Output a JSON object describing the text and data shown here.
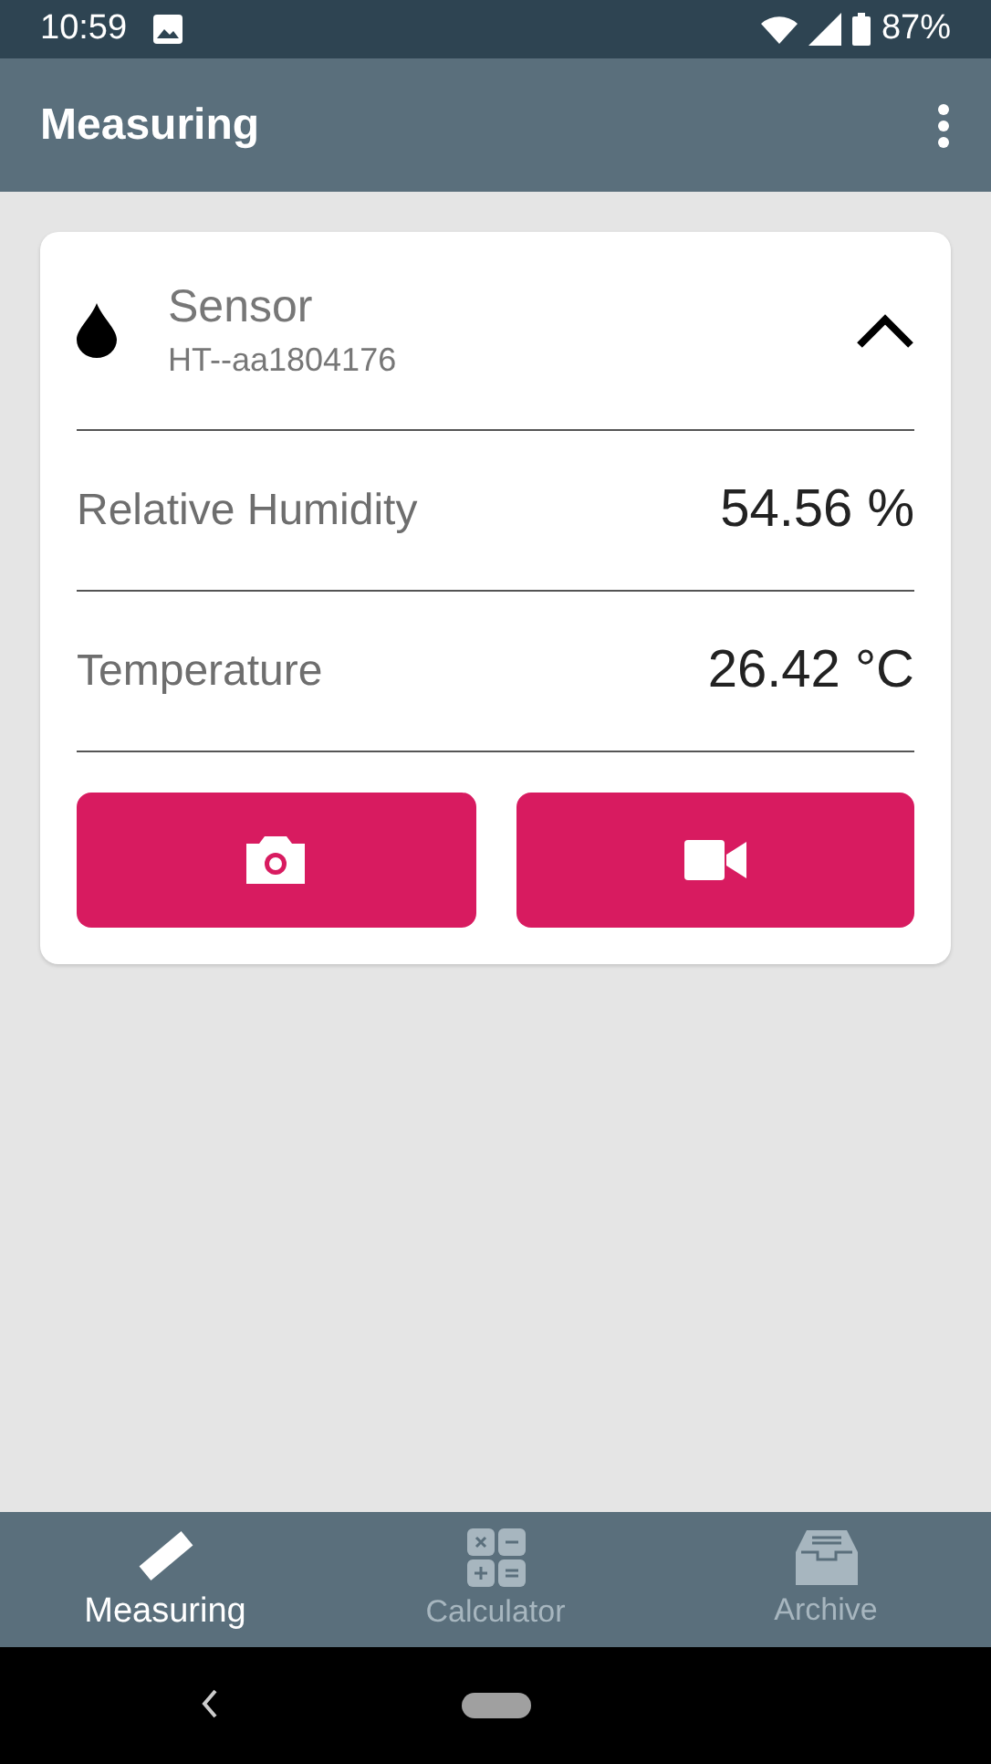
{
  "status_bar": {
    "time": "10:59",
    "battery": "87%"
  },
  "app_bar": {
    "title": "Measuring"
  },
  "sensor_card": {
    "title": "Sensor",
    "subtitle": "HT--aa1804176",
    "expanded": true,
    "readings": [
      {
        "label": "Relative Humidity",
        "value": "54.56 %"
      },
      {
        "label": "Temperature",
        "value": "26.42 °C"
      }
    ],
    "buttons": [
      {
        "kind": "photo"
      },
      {
        "kind": "video"
      }
    ]
  },
  "bottom_nav": [
    {
      "label": "Measuring",
      "kind": "ruler",
      "selected": true
    },
    {
      "label": "Calculator",
      "kind": "calculator",
      "selected": false
    },
    {
      "label": "Archive",
      "kind": "archive",
      "selected": false
    }
  ]
}
